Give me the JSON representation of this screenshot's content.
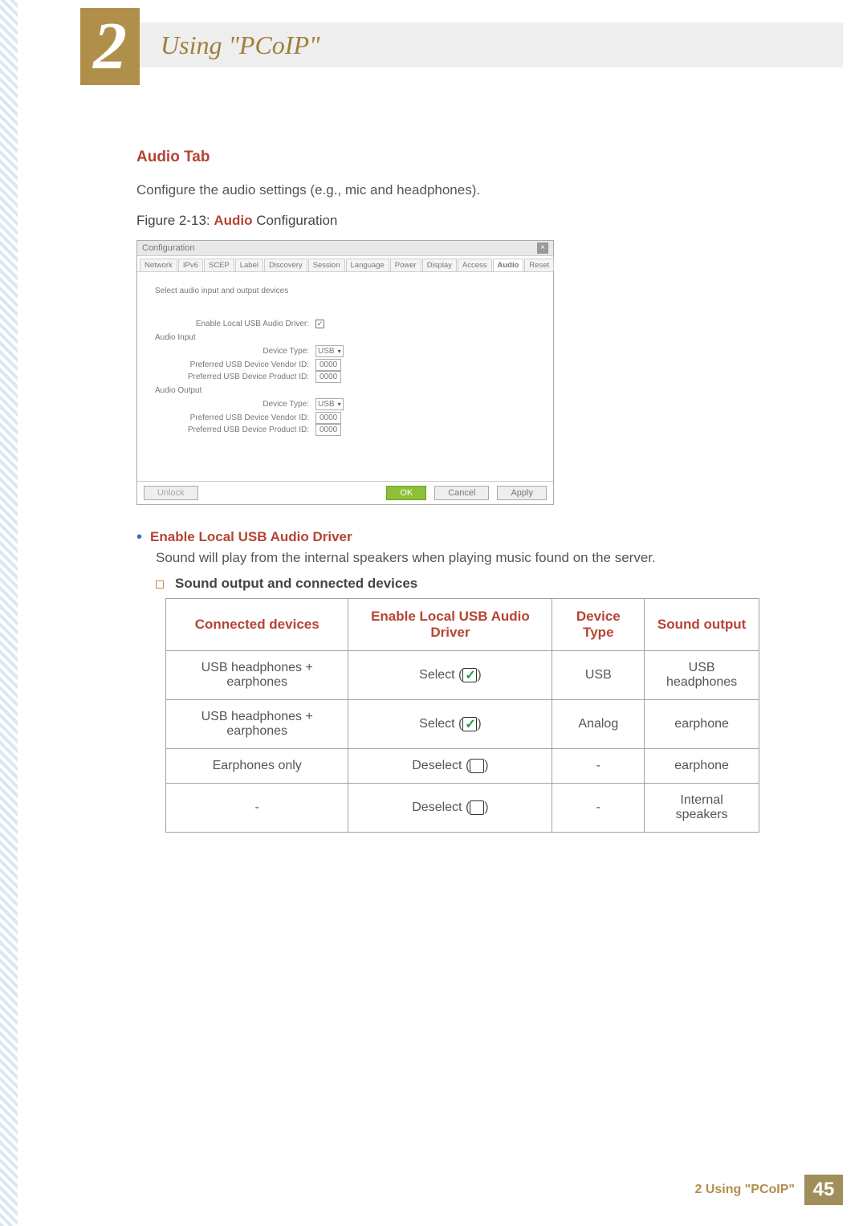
{
  "header": {
    "chapter_number": "2",
    "chapter_title": "Using \"PCoIP\""
  },
  "section": {
    "heading": "Audio Tab",
    "intro": "Configure the audio settings (e.g., mic and headphones).",
    "figure_label_prefix": "Figure 2-13: ",
    "figure_label_bold": "Audio",
    "figure_label_suffix": " Configuration"
  },
  "dialog": {
    "title": "Configuration",
    "close_label": "×",
    "tabs": [
      "Network",
      "IPv6",
      "SCEP",
      "Label",
      "Discovery",
      "Session",
      "Language",
      "Power",
      "Display",
      "Access",
      "Audio",
      "Reset"
    ],
    "selected_tab": "Audio",
    "instruction": "Select audio input and output devices",
    "enable_label": "Enable Local USB Audio Driver:",
    "audio_input_label": "Audio Input",
    "audio_output_label": "Audio Output",
    "device_type_label": "Device Type:",
    "vendor_label": "Preferred USB Device Vendor ID:",
    "product_label": "Preferred USB Device Product ID:",
    "device_type_value": "USB",
    "vendor_value": "0000",
    "product_value": "0000",
    "buttons": {
      "unlock": "Unlock",
      "ok": "OK",
      "cancel": "Cancel",
      "apply": "Apply"
    }
  },
  "bullet": {
    "title": "Enable Local USB Audio Driver",
    "desc": "Sound will play from the internal speakers when playing music found on the server.",
    "sub_title": "Sound output and connected devices"
  },
  "table": {
    "headers": [
      "Connected devices",
      "Enable Local USB Audio Driver",
      "Device Type",
      "Sound output"
    ],
    "rows": [
      {
        "devices": "USB headphones + earphones",
        "enable_text": "Select",
        "enable_checked": true,
        "device_type": "USB",
        "output": "USB headphones"
      },
      {
        "devices": "USB headphones + earphones",
        "enable_text": "Select",
        "enable_checked": true,
        "device_type": "Analog",
        "output": "earphone"
      },
      {
        "devices": "Earphones only",
        "enable_text": "Deselect",
        "enable_checked": false,
        "device_type": "-",
        "output": "earphone"
      },
      {
        "devices": "-",
        "enable_text": "Deselect",
        "enable_checked": false,
        "device_type": "-",
        "output": "Internal speakers"
      }
    ]
  },
  "footer": {
    "text": "2 Using \"PCoIP\"",
    "page": "45"
  }
}
